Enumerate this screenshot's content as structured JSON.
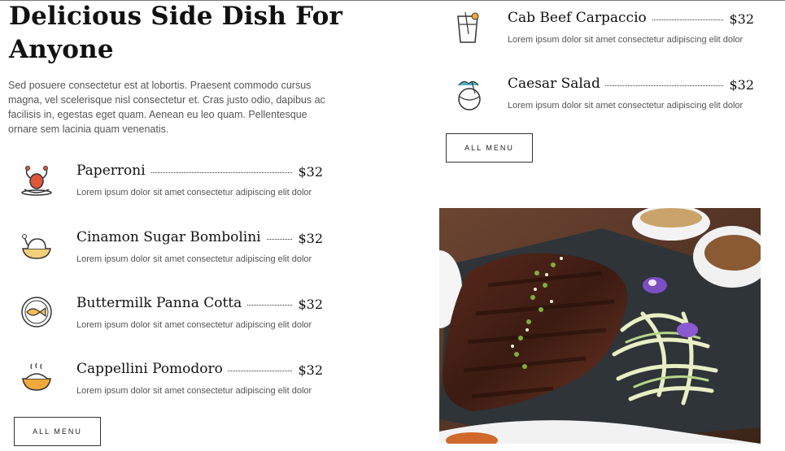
{
  "left": {
    "heading": "Delicious Side Dish For Anyone",
    "intro": "Sed posuere consectetur est at lobortis. Praesent commodo cursus magna, vel scelerisque nisl consectetur et. Cras justo odio, dapibus ac facilisis in, egestas eget quam. Aenean eu leo quam. Pellentesque ornare sem lacinia quam venenatis.",
    "items": [
      {
        "name": "Paperroni",
        "price": "$32",
        "desc": "Lorem ipsum dolor sit amet consectetur adipiscing elit dolor",
        "icon": "lobster-dish-icon"
      },
      {
        "name": "Cinamon Sugar Bombolini",
        "price": "$32",
        "desc": "Lorem ipsum dolor sit amet consectetur adipiscing elit dolor",
        "icon": "chicken-bowl-icon"
      },
      {
        "name": "Buttermilk Panna Cotta",
        "price": "$32",
        "desc": "Lorem ipsum dolor sit amet consectetur adipiscing elit dolor",
        "icon": "fish-plate-icon"
      },
      {
        "name": "Cappellini Pomodoro",
        "price": "$32",
        "desc": "Lorem ipsum dolor sit amet consectetur adipiscing elit dolor",
        "icon": "hot-soup-icon"
      }
    ],
    "button_label": "ALL MENU"
  },
  "right": {
    "items": [
      {
        "name": "Cab Beef Carpaccio",
        "price": "$32",
        "desc": "Lorem ipsum dolor sit amet consectetur adipiscing elit dolor",
        "icon": "drink-glass-icon"
      },
      {
        "name": "Caesar Salad",
        "price": "$32",
        "desc": "Lorem ipsum dolor sit amet consectetur adipiscing elit dolor",
        "icon": "coconut-drink-icon"
      }
    ],
    "button_label": "ALL MENU"
  },
  "colors": {
    "accent": "#e8a33a",
    "accent_red": "#e0563b",
    "text": "#111111"
  }
}
